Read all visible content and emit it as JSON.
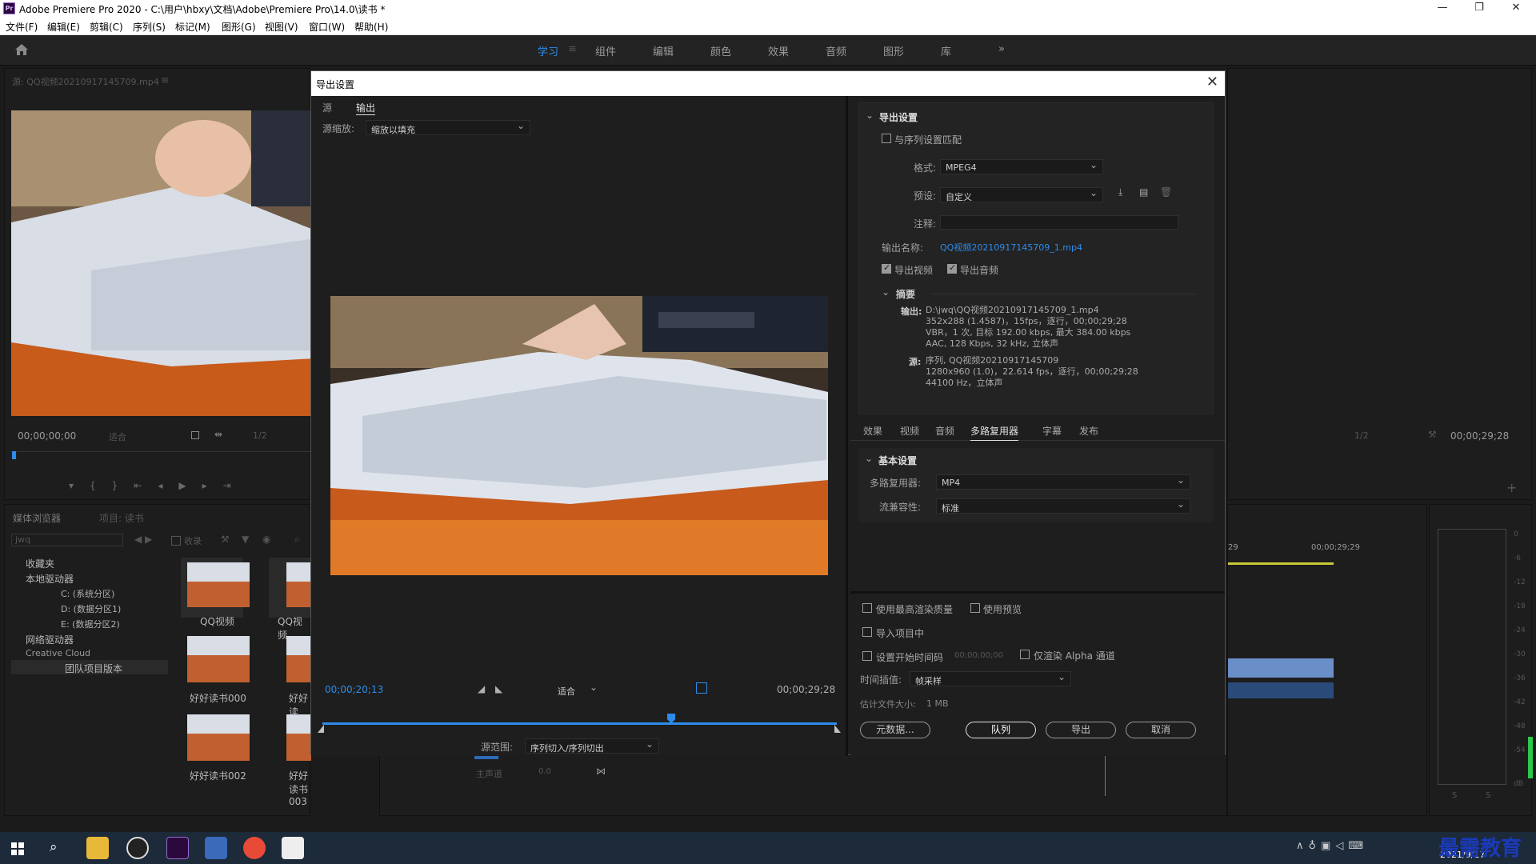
{
  "titlebar": {
    "title": "Adobe Premiere Pro 2020 - C:\\用户\\hbxy\\文档\\Adobe\\Premiere Pro\\14.0\\读书 *",
    "app_icon": "Pr",
    "minimize": "—",
    "maximize": "❐",
    "close": "✕"
  },
  "menu": [
    "文件(F)",
    "编辑(E)",
    "剪辑(C)",
    "序列(S)",
    "标记(M)",
    "图形(G)",
    "视图(V)",
    "窗口(W)",
    "帮助(H)"
  ],
  "workspaces": {
    "home_icon": "home-icon",
    "tabs": [
      "学习",
      "组件",
      "编辑",
      "颜色",
      "效果",
      "音频",
      "图形",
      "库"
    ],
    "active": "学习",
    "more": "»",
    "menu_icon": "≡"
  },
  "source_panel": {
    "title": "源: QQ视频20210917145709.mp4",
    "menu_icon": "≡",
    "timecode": "00;00;00;00",
    "fit": "适合",
    "ratio": "1/2"
  },
  "program_panel": {
    "ratio": "1/2",
    "timecode": "00;00;29;28"
  },
  "media_browser": {
    "tabs": [
      "媒体浏览器",
      "项目: 读书"
    ],
    "search": "jwq",
    "ingest": "收录",
    "tree": [
      "收藏夹",
      "本地驱动器",
      "C: (系统分区)",
      "D: (数据分区1)",
      "E: (数据分区2)",
      "网络驱动器",
      "Creative Cloud",
      "团队项目版本"
    ],
    "thumbs": [
      "QQ视频",
      "QQ视频",
      "好好读书000",
      "好好读",
      "好好读书002",
      "好好读书003"
    ]
  },
  "timeline": {
    "label_29": "29",
    "tc": "00;00;29;29",
    "master": "主声道",
    "master_val": "0.0"
  },
  "meter": {
    "scale": [
      "0",
      "-6",
      "-12",
      "-18",
      "-24",
      "-30",
      "-36",
      "-42",
      "-48",
      "-54",
      "dB"
    ],
    "solo": [
      "S",
      "S"
    ]
  },
  "dialog": {
    "title": "导出设置",
    "close": "✕",
    "left": {
      "tabs": [
        "源",
        "输出"
      ],
      "active": "输出",
      "scale_label": "源缩放:",
      "scale_value": "缩放以填充",
      "tc_in": "00;00;20;13",
      "fit": "适合",
      "tc_out": "00;00;29;28",
      "range_label": "源范围:",
      "range_value": "序列切入/序列切出"
    },
    "export_settings": {
      "heading": "导出设置",
      "match_seq": "与序列设置匹配",
      "format_label": "格式:",
      "format": "MPEG4",
      "preset_label": "预设:",
      "preset": "自定义",
      "comment_label": "注释:",
      "comment": "",
      "output_name_label": "输出名称:",
      "output_name": "QQ视频20210917145709_1.mp4",
      "export_video": "导出视频",
      "export_audio": "导出音频",
      "summary_heading": "摘要",
      "out_label": "输出:",
      "out_lines": [
        "D:\\jwq\\QQ视频20210917145709_1.mp4",
        "352x288 (1.4587)，15fps，逐行，00;00;29;28",
        "VBR，1 次, 目标 192.00 kbps, 最大 384.00 kbps",
        "AAC, 128 Kbps, 32  kHz, 立体声"
      ],
      "src_label": "源:",
      "src_lines": [
        "序列, QQ视频20210917145709",
        "1280x960 (1.0)，22.614 fps，逐行，00;00;29;28",
        "44100 Hz，立体声"
      ]
    },
    "tabs2": [
      "效果",
      "视频",
      "音频",
      "多路复用器",
      "字幕",
      "发布"
    ],
    "tabs2_active": "多路复用器",
    "basic": {
      "heading": "基本设置",
      "mux_label": "多路复用器:",
      "mux": "MP4",
      "compat_label": "流兼容性:",
      "compat": "标准"
    },
    "bottom": {
      "max_quality": "使用最高渲染质量",
      "use_previews": "使用预览",
      "import_project": "导入项目中",
      "set_tc": "设置开始时间码",
      "set_tc_val": "00;00;00;00",
      "alpha_only": "仅渲染 Alpha 通道",
      "interp_label": "时间插值:",
      "interp": "帧采样",
      "filesize_label": "估计文件大小:",
      "filesize": "1 MB",
      "metadata": "元数据...",
      "queue": "队列",
      "export": "导出",
      "cancel": "取消"
    }
  },
  "taskbar": {
    "date": "2021/9/17",
    "watermark": "最需教育"
  },
  "colors": {
    "accent": "#2d8ceb",
    "bg": "#1e1e1e",
    "titlebar": "#ffffff"
  }
}
